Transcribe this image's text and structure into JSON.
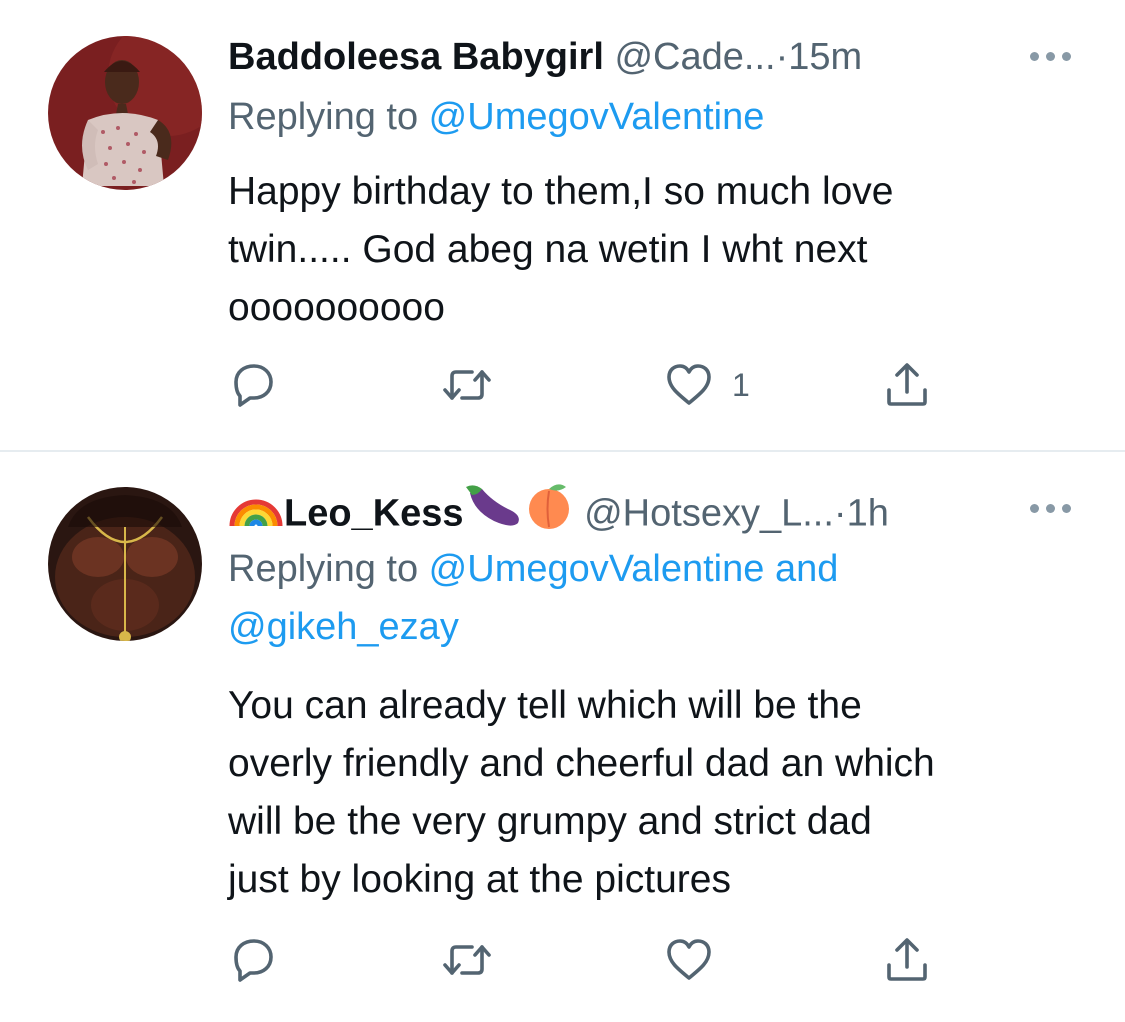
{
  "tweets": [
    {
      "display_name": "Baddoleesa Babygirl",
      "handle": "@Cade...",
      "separator": "·",
      "time": "15m",
      "replying_prefix": "Replying to ",
      "replying_to": "@UmegovValentine",
      "body_lines": [
        "Happy birthday to them,I so much love",
        "twin..... God abeg na wetin I wht next",
        "oooooooooo"
      ],
      "like_count": "1"
    },
    {
      "name_prefix_emoji": "rainbow-emoji",
      "display_name": "Leo_Kess",
      "name_suffix_emojis": [
        "eggplant-emoji",
        "peach-emoji"
      ],
      "handle": "@Hotsexy_L...",
      "separator": "·",
      "time": "1h",
      "replying_prefix": "Replying to ",
      "replying_to": "@UmegovValentine",
      "replying_joiner": " and",
      "replying_to_2": "@gikeh_ezay",
      "body_lines": [
        "You can already tell which will be the",
        "overly friendly and cheerful dad an which",
        "will be the very grumpy and strict dad",
        "just by looking at the pictures"
      ],
      "like_count": ""
    }
  ],
  "icons": {
    "reply": "reply-icon",
    "retweet": "retweet-icon",
    "like": "heart-icon",
    "share": "share-icon",
    "more": "more-icon"
  },
  "colors": {
    "text": "#0f1419",
    "secondary": "#536471",
    "link": "#1d9bf0",
    "divider": "#e6ecf0",
    "icon": "#536471"
  }
}
